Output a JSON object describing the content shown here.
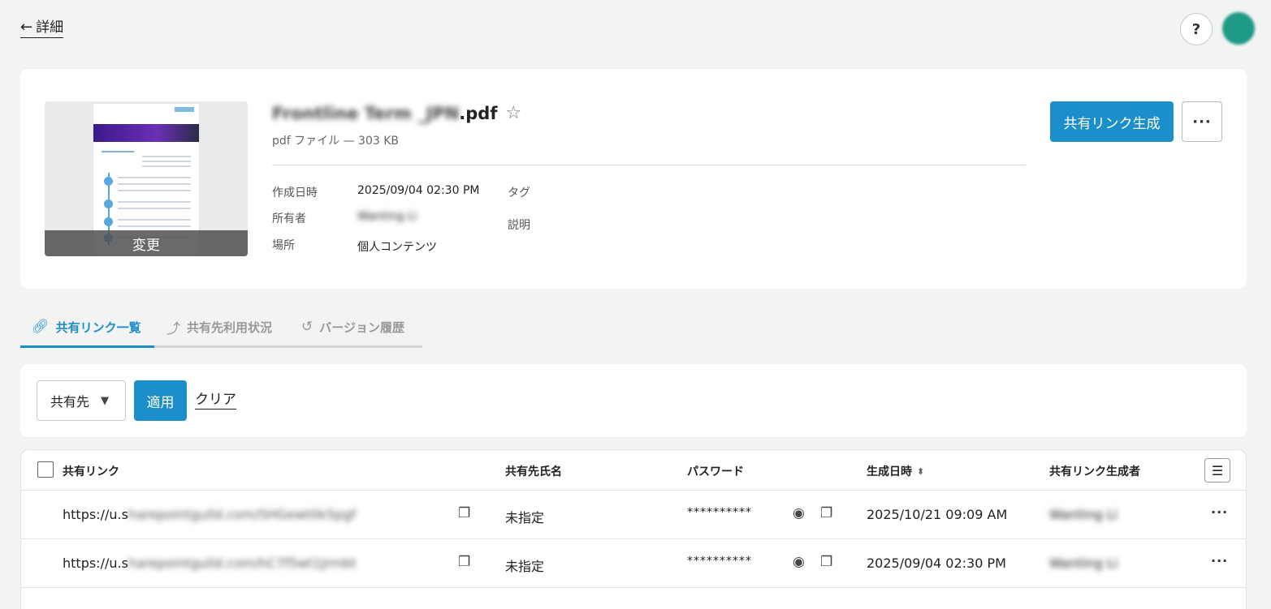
{
  "header": {
    "back_label": "詳細",
    "help_label": "?"
  },
  "file": {
    "name_blurred": "Frontline Term _JPN",
    "name_ext": ".pdf",
    "meta": "pdf ファイル — 303 KB",
    "thumbnail_change_label": "変更",
    "props": {
      "created_label": "作成日時",
      "created_value": "2025/09/04 02:30 PM",
      "owner_label": "所有者",
      "owner_value_blurred": "Wanting Li",
      "location_label": "場所",
      "location_value": "個人コンテンツ",
      "tags_label": "タグ",
      "description_label": "説明"
    },
    "create_link_label": "共有リンク生成",
    "more_label": "···"
  },
  "tabs": [
    {
      "label": "共有リンク一覧",
      "icon": "link-icon",
      "active": true
    },
    {
      "label": "共有先利用状況",
      "icon": "analytics-icon",
      "active": false
    },
    {
      "label": "バージョン履歴",
      "icon": "history-icon",
      "active": false
    }
  ],
  "filter": {
    "select_value": "共有先",
    "apply_label": "適用",
    "clear_label": "クリア"
  },
  "table": {
    "headers": {
      "link": "共有リンク",
      "recipient": "共有先氏名",
      "password": "パスワード",
      "created": "生成日時",
      "creator": "共有リンク生成者"
    },
    "rows": [
      {
        "url_prefix": "https://u.s",
        "url_blurred": "harepointgulld.com/SHGewt0k5pgf",
        "recipient": "未指定",
        "password": "**********",
        "created": "2025/10/21 09:09 AM",
        "creator_blurred": "Wanting Li"
      },
      {
        "url_prefix": "https://u.s",
        "url_blurred": "harepointgulld.com/hC7f5wt1Jrmbt",
        "recipient": "未指定",
        "password": "**********",
        "created": "2025/09/04 02:30 PM",
        "creator_blurred": "Wanting Li"
      }
    ]
  },
  "colors": {
    "accent": "#1c8fca",
    "avatar": "#1f9a86",
    "background": "#f2f3f3"
  }
}
